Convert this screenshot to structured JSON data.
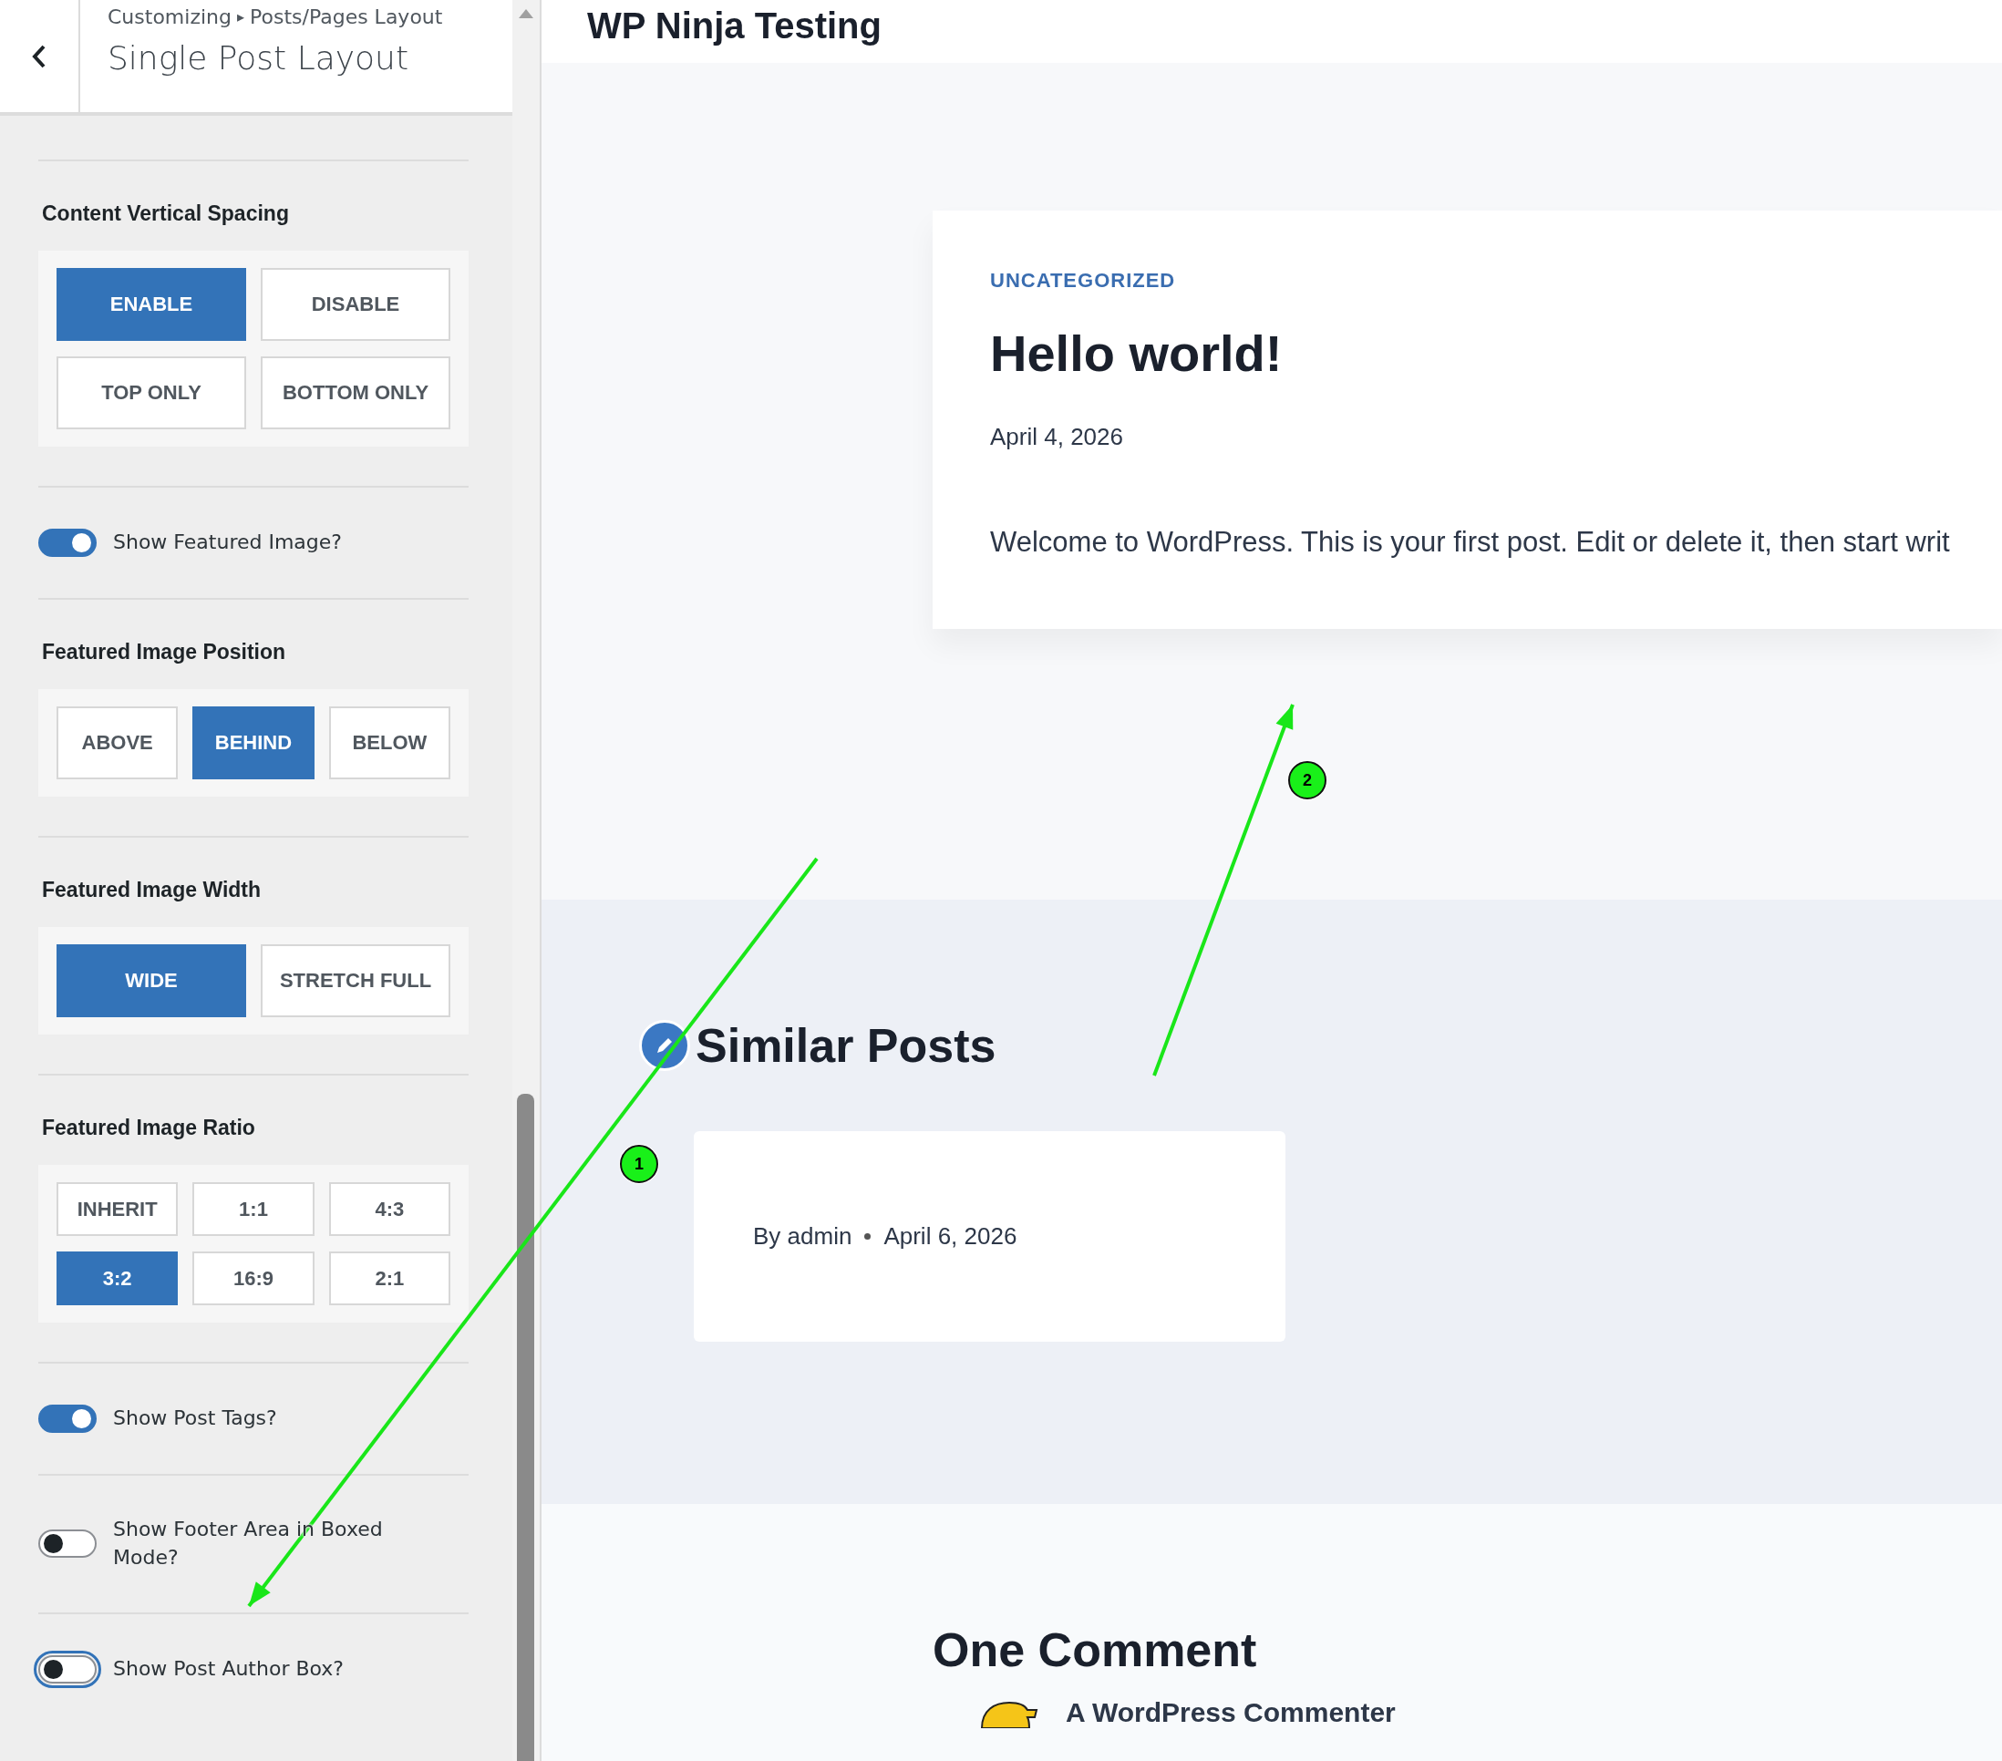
{
  "header": {
    "breadcrumb_root": "Customizing",
    "breadcrumb_separator": "▸",
    "breadcrumb_section": "Posts/Pages Layout",
    "title": "Single Post Layout"
  },
  "sections": [
    {
      "kind": "buttons",
      "title": "Content Vertical Spacing",
      "options": [
        {
          "label": "ENABLE",
          "selected": true
        },
        {
          "label": "DISABLE",
          "selected": false
        },
        {
          "label": "TOP ONLY",
          "selected": false
        },
        {
          "label": "BOTTOM ONLY",
          "selected": false
        }
      ]
    },
    {
      "kind": "toggle",
      "label": "Show Featured Image?",
      "on": true,
      "focused": false
    },
    {
      "kind": "buttons",
      "title": "Featured Image Position",
      "options": [
        {
          "label": "ABOVE",
          "selected": false
        },
        {
          "label": "BEHIND",
          "selected": true
        },
        {
          "label": "BELOW",
          "selected": false
        }
      ]
    },
    {
      "kind": "buttons",
      "title": "Featured Image Width",
      "options": [
        {
          "label": "WIDE",
          "selected": true
        },
        {
          "label": "STRETCH FULL",
          "selected": false
        }
      ]
    },
    {
      "kind": "buttons",
      "title": "Featured Image Ratio",
      "options": [
        {
          "label": "INHERIT",
          "selected": false
        },
        {
          "label": "1:1",
          "selected": false
        },
        {
          "label": "4:3",
          "selected": false
        },
        {
          "label": "3:2",
          "selected": true
        },
        {
          "label": "16:9",
          "selected": false
        },
        {
          "label": "2:1",
          "selected": false
        }
      ]
    },
    {
      "kind": "toggle",
      "label": "Show Post Tags?",
      "on": true,
      "focused": false
    },
    {
      "kind": "toggle",
      "label": "Show Footer Area in Boxed Mode?",
      "on": false,
      "focused": false
    },
    {
      "kind": "toggle",
      "label": "Show Post Author Box?",
      "on": false,
      "focused": true
    }
  ],
  "preview": {
    "site_title": "WP Ninja Testing",
    "post": {
      "category": "UNCATEGORIZED",
      "title": "Hello world!",
      "date": "April 4, 2026",
      "excerpt": "Welcome to WordPress. This is your first post. Edit or delete it, then start writ"
    },
    "similar": {
      "title": "Similar Posts",
      "cards": [
        {
          "author": "By admin",
          "date": "April 6, 2026"
        }
      ]
    },
    "comments": {
      "title": "One Comment",
      "first_author": "A WordPress Commenter"
    }
  },
  "annotations": [
    {
      "label": "1"
    },
    {
      "label": "2"
    }
  ]
}
